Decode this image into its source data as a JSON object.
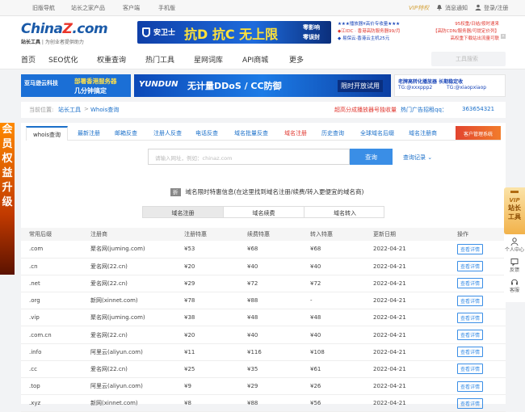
{
  "topbar": {
    "left_links": [
      "旧版导航",
      "站长之家产品",
      "客户端",
      "手机版"
    ],
    "vip": "VIP特权",
    "messages": "消息通知",
    "login": "登录/注册"
  },
  "header": {
    "brand_main": "China",
    "brand_z": "Z",
    "brand_tail": ".com",
    "slogan_bold": "站长工具",
    "slogan_rest": "为创业者提供助力",
    "banner1_brand": "安卫士",
    "banner1_text": "抗D 抗C 无上限",
    "banner1_side1": "零影响",
    "banner1_side2": "零误封",
    "banner2_lines": [
      "★★★播放器¥高价专收量★★★",
      "◆江IDC · 香港高防服务器99/月",
      "◆ 易保云·香港云主机25元"
    ],
    "banner3_lines": [
      "95权重/日结/按时速来",
      "【高防CDN/服务器/可提定价列】",
      "高权重下载站出流量可联"
    ]
  },
  "nav": {
    "items": [
      "首页",
      "SEO优化",
      "权重查询",
      "热门工具",
      "星网词库",
      "API商城",
      "更多"
    ],
    "search_placeholder": "工具搜索"
  },
  "ads": {
    "ad1_title": "亚马逊云科技",
    "ad1_line1": "部署香港服务器",
    "ad1_line2": "几分钟搞定",
    "ad2_brand": "YUNDUN",
    "ad2_text": "无计量DDoS / CC防御",
    "ad2_cta": "限时开放试用",
    "ad3_line1": "老牌高转化播放器  长期稳定收",
    "ad3_line2": "TG:@xxxppp2",
    "ad3_line3": "TG:@xiaopxiaop"
  },
  "crumb": {
    "label": "当前位置:",
    "home": "站长工具",
    "sep": ">",
    "current": "Whois查询",
    "promo": "超高分成播放器号独收量",
    "hotline_label": "热门广告招租qq：",
    "hotline": "363654321"
  },
  "tabs": [
    "whois查询",
    "最新注册",
    "邮箱反查",
    "注册人反查",
    "电话反查",
    "域名批量反查",
    "域名注册",
    "历史查询",
    "全球域名后缀",
    "域名注册商"
  ],
  "tab_badge": "客户管理系统",
  "search": {
    "placeholder": "请输入网址，例如：chinaz.com",
    "button": "查询",
    "records": "查询记录"
  },
  "notice": {
    "badge": "折",
    "text": "域名限时特惠信息(在这里找到域名注册/续费/转入更便宜的域名商)"
  },
  "segments": [
    "域名注册",
    "域名续费",
    "域名转入"
  ],
  "table": {
    "headers": [
      "常用后缀",
      "注册商",
      "注册特惠",
      "续费特惠",
      "转入特惠",
      "更新日期",
      "操作"
    ],
    "action_label": "查看详情",
    "rows": [
      [
        ".com",
        "聚名网(juming.com)",
        "¥53",
        "¥68",
        "¥68",
        "2022-04-21"
      ],
      [
        ".cn",
        "爱名网(22.cn)",
        "¥20",
        "¥40",
        "¥40",
        "2022-04-21"
      ],
      [
        ".net",
        "爱名网(22.cn)",
        "¥29",
        "¥72",
        "¥72",
        "2022-04-21"
      ],
      [
        ".org",
        "新网(xinnet.com)",
        "¥78",
        "¥88",
        "-",
        "2022-04-21"
      ],
      [
        ".vip",
        "聚名网(juming.com)",
        "¥38",
        "¥48",
        "¥48",
        "2022-04-21"
      ],
      [
        ".com.cn",
        "爱名网(22.cn)",
        "¥20",
        "¥40",
        "¥40",
        "2022-04-21"
      ],
      [
        ".info",
        "阿里云(aliyun.com)",
        "¥11",
        "¥116",
        "¥108",
        "2022-04-21"
      ],
      [
        ".cc",
        "爱名网(22.cn)",
        "¥25",
        "¥35",
        "¥61",
        "2022-04-21"
      ],
      [
        ".top",
        "阿里云(aliyun.com)",
        "¥9",
        "¥29",
        "¥26",
        "2022-04-21"
      ],
      [
        ".xyz",
        "新网(xinnet.com)",
        "¥8",
        "¥88",
        "¥56",
        "2022-04-21"
      ]
    ]
  },
  "left_ad_text": "会员权益升级",
  "side": {
    "vip_line1": "VIP",
    "vip_line2": "站长",
    "vip_line3": "工具",
    "center": "个人中心",
    "feedback": "反馈",
    "service": "客服"
  }
}
